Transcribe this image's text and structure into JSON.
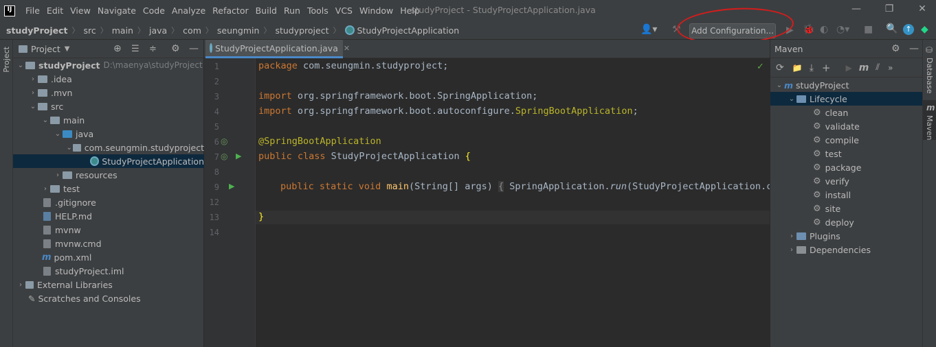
{
  "window": {
    "title": "studyProject - StudyProjectApplication.java",
    "menu": [
      "File",
      "Edit",
      "View",
      "Navigate",
      "Code",
      "Analyze",
      "Refactor",
      "Build",
      "Run",
      "Tools",
      "VCS",
      "Window",
      "Help"
    ]
  },
  "breadcrumbs": [
    "studyProject",
    "src",
    "main",
    "java",
    "com",
    "seungmin",
    "studyproject",
    "StudyProjectApplication"
  ],
  "toolbar": {
    "add_config_label": "Add Configuration..."
  },
  "project_panel": {
    "title": "Project",
    "root_label": "studyProject",
    "root_path": "D:\\maenya\\studyProject",
    "tree": [
      ".idea",
      ".mvn",
      "src",
      "main",
      "java",
      "com.seungmin.studyproject",
      "StudyProjectApplication",
      "resources",
      "test",
      ".gitignore",
      "HELP.md",
      "mvnw",
      "mvnw.cmd",
      "pom.xml",
      "studyProject.iml",
      "External Libraries",
      "Scratches and Consoles"
    ]
  },
  "editor": {
    "tab_label": "StudyProjectApplication.java",
    "line_numbers": [
      "1",
      "2",
      "3",
      "4",
      "5",
      "6",
      "7",
      "8",
      "9",
      "12",
      "13",
      "14"
    ],
    "code": {
      "pkg_kw": "package",
      "pkg_name": " com.seungmin.studyproject;",
      "import_kw": "import",
      "import1": " org.springframework.boot.SpringApplication;",
      "import2_a": " org.springframework.boot.autoconfigure.",
      "import2_b": "SpringBootApplication",
      "import2_c": ";",
      "annotation": "@SpringBootApplication",
      "class_kw": "public class",
      "class_name": " StudyProjectApplication ",
      "brace_open": "{",
      "main_kw": "public static void",
      "main_name": "main",
      "main_params": "(String[] args) ",
      "body_brace": "{",
      "body_a": " SpringApplication.",
      "body_run": "run",
      "body_b": "(StudyProjectApplication.cl",
      "brace_close": "}"
    }
  },
  "maven_panel": {
    "title": "Maven",
    "project": "studyProject",
    "lifecycle": "Lifecycle",
    "goals": [
      "clean",
      "validate",
      "compile",
      "test",
      "package",
      "verify",
      "install",
      "site",
      "deploy"
    ],
    "plugins": "Plugins",
    "dependencies": "Dependencies"
  },
  "side_tabs": {
    "left": "Project",
    "right_top": "Database",
    "right_bottom": "Maven"
  }
}
